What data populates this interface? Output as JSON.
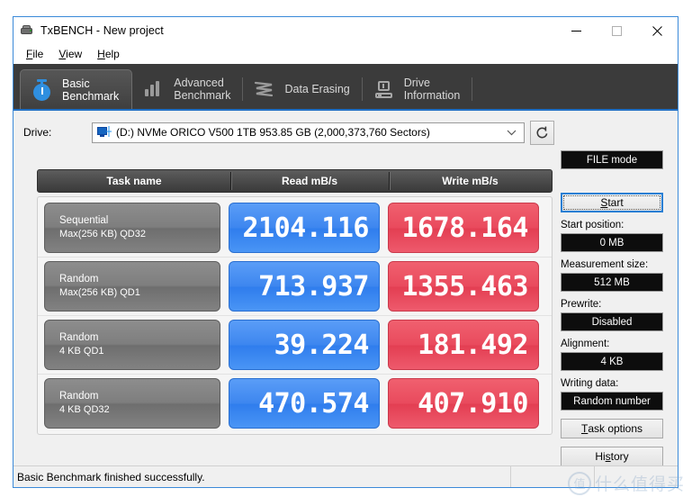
{
  "window": {
    "title": "TxBENCH - New project",
    "icon": "app-icon",
    "controls": {
      "minimize": "minimize-icon",
      "maximize": "maximize-icon",
      "close": "close-icon"
    }
  },
  "menu": {
    "items": [
      {
        "label": "File",
        "accel": "F"
      },
      {
        "label": "View",
        "accel": "V"
      },
      {
        "label": "Help",
        "accel": "H"
      }
    ]
  },
  "tabs": [
    {
      "label": "Basic\nBenchmark",
      "icon": "stopwatch-icon",
      "active": true
    },
    {
      "label": "Advanced\nBenchmark",
      "icon": "bar-chart-icon",
      "active": false
    },
    {
      "label": "Data Erasing",
      "icon": "shredder-icon",
      "active": false
    },
    {
      "label": "Drive\nInformation",
      "icon": "drive-info-icon",
      "active": false
    }
  ],
  "drive": {
    "label": "Drive:",
    "icon": "drive-icon",
    "selected": "(D:) NVMe ORICO V500 1TB  953.85 GB (2,000,373,760 Sectors)",
    "dropdown_icon": "chevron-down-icon",
    "refresh_icon": "refresh-icon"
  },
  "results": {
    "columns": [
      "Task name",
      "Read mB/s",
      "Write mB/s"
    ],
    "rows": [
      {
        "name": "Sequential",
        "detail": "Max(256 KB) QD32",
        "read": "2104.116",
        "write": "1678.164"
      },
      {
        "name": "Random",
        "detail": "Max(256 KB) QD1",
        "read": "713.937",
        "write": "1355.463"
      },
      {
        "name": "Random",
        "detail": "4 KB QD1",
        "read": "39.224",
        "write": "181.492"
      },
      {
        "name": "Random",
        "detail": "4 KB QD32",
        "read": "470.574",
        "write": "407.910"
      }
    ]
  },
  "side": {
    "mode": "FILE mode",
    "start_button": "Start",
    "start_accel": "S",
    "fields": [
      {
        "label": "Start position:",
        "value": "0 MB"
      },
      {
        "label": "Measurement size:",
        "value": "512 MB"
      },
      {
        "label": "Prewrite:",
        "value": "Disabled"
      },
      {
        "label": "Alignment:",
        "value": "4 KB"
      },
      {
        "label": "Writing data:",
        "value": "Random number"
      }
    ],
    "task_options": "Task options",
    "task_options_accel": "T",
    "history": "History",
    "history_accel": "s"
  },
  "status": {
    "message": "Basic Benchmark finished successfully."
  },
  "watermark": {
    "mark": "值",
    "text": "什么值得买"
  },
  "colors": {
    "read": "#3d86ef",
    "write": "#e94a5d",
    "accent": "#2a7fd4",
    "tabstrip": "#3b3b3b",
    "panel": "#f0f0f0"
  }
}
